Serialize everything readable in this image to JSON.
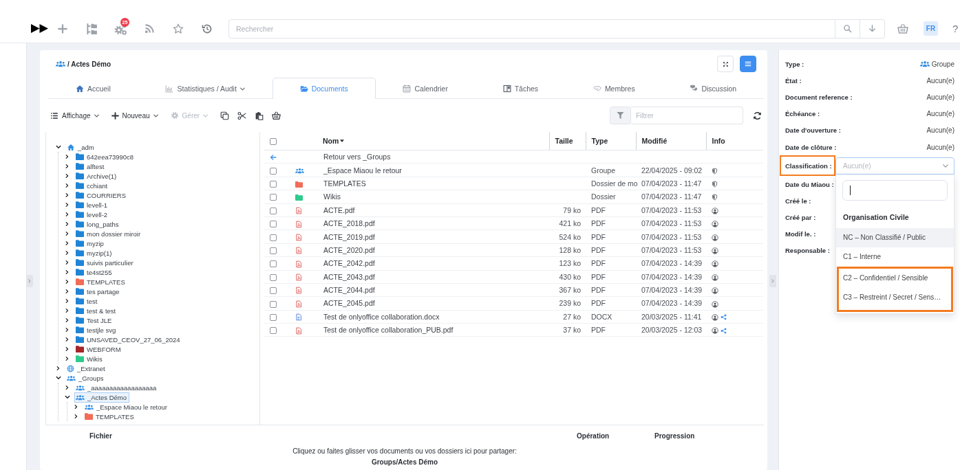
{
  "top_bar": {
    "notifications": "25",
    "search": {
      "placeholder": "Rechercher"
    },
    "language": "FR",
    "help": "?"
  },
  "header": {
    "title": "/ Actes Démo"
  },
  "tabs": [
    {
      "label": "Accueil",
      "selected": false,
      "dropdown": false
    },
    {
      "label": "Statistiques / Audit",
      "selected": false,
      "dropdown": true
    },
    {
      "label": "Documents",
      "selected": true,
      "dropdown": false
    },
    {
      "label": "Calendrier",
      "selected": false,
      "dropdown": false
    },
    {
      "label": "Tâches",
      "selected": false,
      "dropdown": false
    },
    {
      "label": "Membres",
      "selected": false,
      "dropdown": false
    },
    {
      "label": "Discussion",
      "selected": false,
      "dropdown": false
    }
  ],
  "toolbar": {
    "menus": [
      {
        "label": "Affichage",
        "disabled": false
      },
      {
        "label": "Nouveau",
        "disabled": false
      },
      {
        "label": "Gérer",
        "disabled": true
      }
    ],
    "filter": {
      "placeholder": "Filtrer"
    }
  },
  "tree": [
    {
      "label": "_adm",
      "kind": "home",
      "expanded": true,
      "selected": false,
      "children": [
        {
          "label": "642eea73990c8",
          "kind": "folder",
          "color": "#1f84d6",
          "expanded": false,
          "selected": false
        },
        {
          "label": "alftest",
          "kind": "folder",
          "color": "#1f84d6",
          "expanded": false,
          "selected": false
        },
        {
          "label": "Archive(1)",
          "kind": "folder",
          "color": "#1f84d6",
          "expanded": false,
          "selected": false
        },
        {
          "label": "cchiant",
          "kind": "folder",
          "color": "#1f84d6",
          "expanded": false,
          "selected": false
        },
        {
          "label": "COURRIERS",
          "kind": "folder",
          "color": "#1f84d6",
          "expanded": false,
          "selected": false
        },
        {
          "label": "levell-1",
          "kind": "folder",
          "color": "#1f84d6",
          "expanded": false,
          "selected": false
        },
        {
          "label": "levell-2",
          "kind": "folder",
          "color": "#1f84d6",
          "expanded": false,
          "selected": false
        },
        {
          "label": "long_paths",
          "kind": "folder",
          "color": "#1f84d6",
          "expanded": false,
          "selected": false
        },
        {
          "label": "mon dossier miroir",
          "kind": "folder",
          "color": "#1f84d6",
          "expanded": false,
          "selected": false
        },
        {
          "label": "myzip",
          "kind": "folder",
          "color": "#1f84d6",
          "expanded": false,
          "selected": false
        },
        {
          "label": "myzip(1)",
          "kind": "folder",
          "color": "#1f84d6",
          "expanded": false,
          "selected": false
        },
        {
          "label": "suivis particulier",
          "kind": "folder",
          "color": "#1f84d6",
          "expanded": false,
          "selected": false
        },
        {
          "label": "te4st255",
          "kind": "folder",
          "color": "#1f84d6",
          "expanded": false,
          "selected": false
        },
        {
          "label": "TEMPLATES",
          "kind": "folder",
          "color": "#f26c57",
          "expanded": false,
          "selected": false
        },
        {
          "label": "tes partage",
          "kind": "folder",
          "color": "#1f84d6",
          "expanded": false,
          "selected": false
        },
        {
          "label": "test",
          "kind": "folder",
          "color": "#1f84d6",
          "expanded": false,
          "selected": false
        },
        {
          "label": "test & test",
          "kind": "folder",
          "color": "#1f84d6",
          "expanded": false,
          "selected": false
        },
        {
          "label": "Test JLE",
          "kind": "folder",
          "color": "#1f84d6",
          "expanded": false,
          "selected": false
        },
        {
          "label": "testjle svg",
          "kind": "folder",
          "color": "#1f84d6",
          "expanded": false,
          "selected": false
        },
        {
          "label": "UNSAVED_CEOV_27_06_2024",
          "kind": "folder",
          "color": "#1f84d6",
          "expanded": false,
          "selected": false
        },
        {
          "label": "WEBFORM",
          "kind": "folder",
          "color": "#a52628",
          "expanded": false,
          "selected": false
        },
        {
          "label": "Wikis",
          "kind": "folder",
          "color": "#2ecb8c",
          "expanded": false,
          "selected": false
        }
      ]
    },
    {
      "label": "_Extranet",
      "kind": "globe",
      "expanded": false,
      "selected": false
    },
    {
      "label": "_Groups",
      "kind": "group",
      "expanded": true,
      "selected": false,
      "children": [
        {
          "label": "_aaaaaaaaaaaaaaaaaa",
          "kind": "group",
          "expanded": false,
          "selected": false
        },
        {
          "label": "_Actes Démo",
          "kind": "group",
          "expanded": true,
          "selected": true,
          "children": [
            {
              "label": "_Espace Miaou le retour",
              "kind": "group",
              "expanded": false,
              "selected": false
            },
            {
              "label": "TEMPLATES",
              "kind": "folder",
              "color": "#f26c57",
              "expanded": false,
              "selected": false
            }
          ]
        }
      ]
    }
  ],
  "table": {
    "all_checked": false,
    "columns": [
      {
        "label": "Nom",
        "sorted": true
      },
      {
        "label": "Taille",
        "sorted": false
      },
      {
        "label": "Type",
        "sorted": false
      },
      {
        "label": "Modifié",
        "sorted": false
      },
      {
        "label": "Info",
        "sorted": false
      }
    ],
    "back_link": "Retour vers _Groups",
    "rows": [
      {
        "kind": "group",
        "name": "_Espace Miaou le retour",
        "type": "Groupe",
        "modified": "22/04/2025 - 09:02",
        "checked": false,
        "shared": false
      },
      {
        "kind": "folder",
        "color": "#f26c57",
        "name": "TEMPLATES",
        "type": "Dossier de mo",
        "modified": "07/04/2023 - 11:47",
        "checked": false,
        "shared": false
      },
      {
        "kind": "folder",
        "color": "#2ecb8c",
        "name": "Wikis",
        "type": "Dossier",
        "modified": "07/04/2023 - 11:47",
        "checked": false,
        "shared": false
      },
      {
        "kind": "pdf",
        "name": "ACTE.pdf",
        "size": "79 ko",
        "type": "PDF",
        "modified": "07/04/2023 - 11:53",
        "checked": false,
        "shared": false
      },
      {
        "kind": "pdf",
        "name": "ACTE_2018.pdf",
        "size": "421 ko",
        "type": "PDF",
        "modified": "07/04/2023 - 11:53",
        "checked": false,
        "shared": false
      },
      {
        "kind": "pdf",
        "name": "ACTE_2019.pdf",
        "size": "524 ko",
        "type": "PDF",
        "modified": "07/04/2023 - 11:53",
        "checked": false,
        "shared": false
      },
      {
        "kind": "pdf",
        "name": "ACTE_2020.pdf",
        "size": "128 ko",
        "type": "PDF",
        "modified": "07/04/2023 - 11:53",
        "checked": false,
        "shared": false
      },
      {
        "kind": "pdf",
        "name": "ACTE_2042.pdf",
        "size": "123 ko",
        "type": "PDF",
        "modified": "07/04/2023 - 14:39",
        "checked": false,
        "shared": false
      },
      {
        "kind": "pdf",
        "name": "ACTE_2043.pdf",
        "size": "430 ko",
        "type": "PDF",
        "modified": "07/04/2023 - 14:39",
        "checked": false,
        "shared": false
      },
      {
        "kind": "pdf",
        "name": "ACTE_2044.pdf",
        "size": "367 ko",
        "type": "PDF",
        "modified": "07/04/2023 - 14:39",
        "checked": false,
        "shared": false
      },
      {
        "kind": "pdf",
        "name": "ACTE_2045.pdf",
        "size": "239 ko",
        "type": "PDF",
        "modified": "07/04/2023 - 14:39",
        "checked": false,
        "shared": false
      },
      {
        "kind": "docx",
        "name": "Test de onlyoffice collaboration.docx",
        "size": "27 ko",
        "type": "DOCX",
        "modified": "20/03/2025 - 11:41",
        "checked": false,
        "shared": true
      },
      {
        "kind": "pdf",
        "name": "Test de onlyoffice collaboration_PUB.pdf",
        "size": "37 ko",
        "type": "PDF",
        "modified": "20/03/2025 - 12:03",
        "checked": false,
        "shared": true
      }
    ]
  },
  "properties": [
    {
      "label": "Type :",
      "kind": "type",
      "value": "Groupe",
      "highlighted": false
    },
    {
      "label": "État :",
      "kind": "text",
      "value": "Aucun(e)",
      "highlighted": false
    },
    {
      "label": "Document reference :",
      "kind": "text",
      "value": "Aucun(e)",
      "highlighted": false
    },
    {
      "label": "Échéance :",
      "kind": "text",
      "value": "Aucun(e)",
      "highlighted": false
    },
    {
      "label": "Date d'ouverture :",
      "kind": "text",
      "value": "Aucun(e)",
      "highlighted": false
    },
    {
      "label": "Date de clôture :",
      "kind": "text",
      "value": "Aucun(e)",
      "highlighted": false
    },
    {
      "label": "Classification :",
      "kind": "select",
      "placeholder": "Aucun(e)",
      "highlighted": true,
      "open": true,
      "dropdown": {
        "group": "Organisation Civile",
        "options": [
          {
            "label": "NC – Non Classifié / Public",
            "selected": true,
            "highlighted": false
          },
          {
            "label": "C1 – Interne",
            "selected": false,
            "highlighted": false
          },
          {
            "label": "C2 – Confidentiel / Sensible",
            "selected": false,
            "highlighted": true
          },
          {
            "label": "C3 – Restreint / Secret / Sens…",
            "selected": false,
            "highlighted": true
          }
        ]
      }
    },
    {
      "label": "Date du Miaou :",
      "kind": "text",
      "highlighted": false
    },
    {
      "label": "Créé le :",
      "kind": "text",
      "highlighted": false
    },
    {
      "label": "Créé par :",
      "kind": "text",
      "highlighted": false
    },
    {
      "label": "Modif le. :",
      "kind": "text",
      "highlighted": false
    },
    {
      "label": "Responsable :",
      "kind": "text",
      "highlighted": false
    }
  ],
  "upload": {
    "columns": [
      "Fichier",
      "Opération",
      "Progression"
    ],
    "message": "Cliquez ou faites glisser vos documents ou vos dossiers ici pour partager:",
    "path": "Groups/Actes Démo"
  }
}
